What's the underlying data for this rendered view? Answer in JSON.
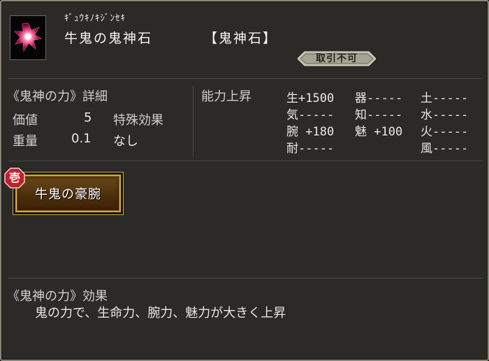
{
  "item": {
    "reading": "ｷﾞｭｳｷﾉｷｼﾞﾝｾｷ",
    "name": "牛鬼の鬼神石",
    "category": "【鬼神石】",
    "trade_status": "取引不可",
    "icon": "crystal-icon"
  },
  "details": {
    "title": "《鬼神の力》詳細",
    "value_label": "価値",
    "value": "5",
    "weight_label": "重量",
    "weight": "0.1",
    "special_label": "特殊効果",
    "special_value": "なし"
  },
  "abilities": {
    "title": "能力上昇",
    "stats": {
      "life": "生+1500",
      "vigor": "気-----",
      "arm": "腕 +180",
      "endurance": "耐-----",
      "dexterity": "器-----",
      "wisdom": "知-----",
      "charm": "魅 +100",
      "earth": "土-----",
      "water": "水-----",
      "fire": "火-----",
      "wind": "風-----"
    }
  },
  "skill": {
    "rank": "壱",
    "name": "牛鬼の豪腕"
  },
  "effect": {
    "title": "《鬼神の力》効果",
    "description": "鬼の力で、生命力、腕力、魅力が大きく上昇"
  },
  "colors": {
    "panel_bg": "#2b2a27",
    "skill_gold": "#d7a83b",
    "rank_red": "#c0202c"
  }
}
